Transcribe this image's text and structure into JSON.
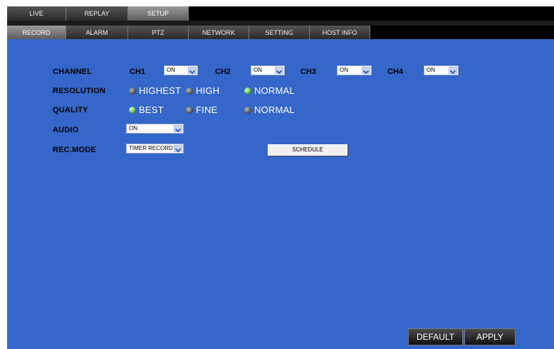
{
  "main_tabs": [
    {
      "label": "LIVE",
      "active": false
    },
    {
      "label": "REPLAY",
      "active": false
    },
    {
      "label": "SETUP",
      "active": true
    }
  ],
  "sub_tabs": [
    {
      "label": "RECORD",
      "active": true
    },
    {
      "label": "ALARM",
      "active": false
    },
    {
      "label": "PTZ",
      "active": false
    },
    {
      "label": "NETWORK",
      "active": false
    },
    {
      "label": "SETTING",
      "active": false
    },
    {
      "label": "HOST INFO",
      "active": false
    }
  ],
  "form": {
    "channel_label": "CHANNEL",
    "channels": [
      {
        "name": "CH1",
        "value": "ON"
      },
      {
        "name": "CH2",
        "value": "ON"
      },
      {
        "name": "CH3",
        "value": "ON"
      },
      {
        "name": "CH4",
        "value": "ON"
      }
    ],
    "resolution_label": "RESOLUTION",
    "resolution_options": [
      {
        "label": "HIGHEST",
        "selected": false
      },
      {
        "label": "HIGH",
        "selected": false
      },
      {
        "label": "NORMAL",
        "selected": true
      }
    ],
    "quality_label": "QUALITY",
    "quality_options": [
      {
        "label": "BEST",
        "selected": true
      },
      {
        "label": "FINE",
        "selected": false
      },
      {
        "label": "NORMAL",
        "selected": false
      }
    ],
    "audio_label": "AUDIO",
    "audio_value": "ON",
    "rec_mode_label": "REC.MODE",
    "rec_mode_value": "TIMER RECORD",
    "schedule_button": "SCHEDULE"
  },
  "footer": {
    "default_button": "DEFAULT",
    "apply_button": "APPLY"
  },
  "colors": {
    "background": "#3566c9",
    "selected_radio": "#2e9b2a",
    "unselected_radio": "#3c3c3c"
  }
}
